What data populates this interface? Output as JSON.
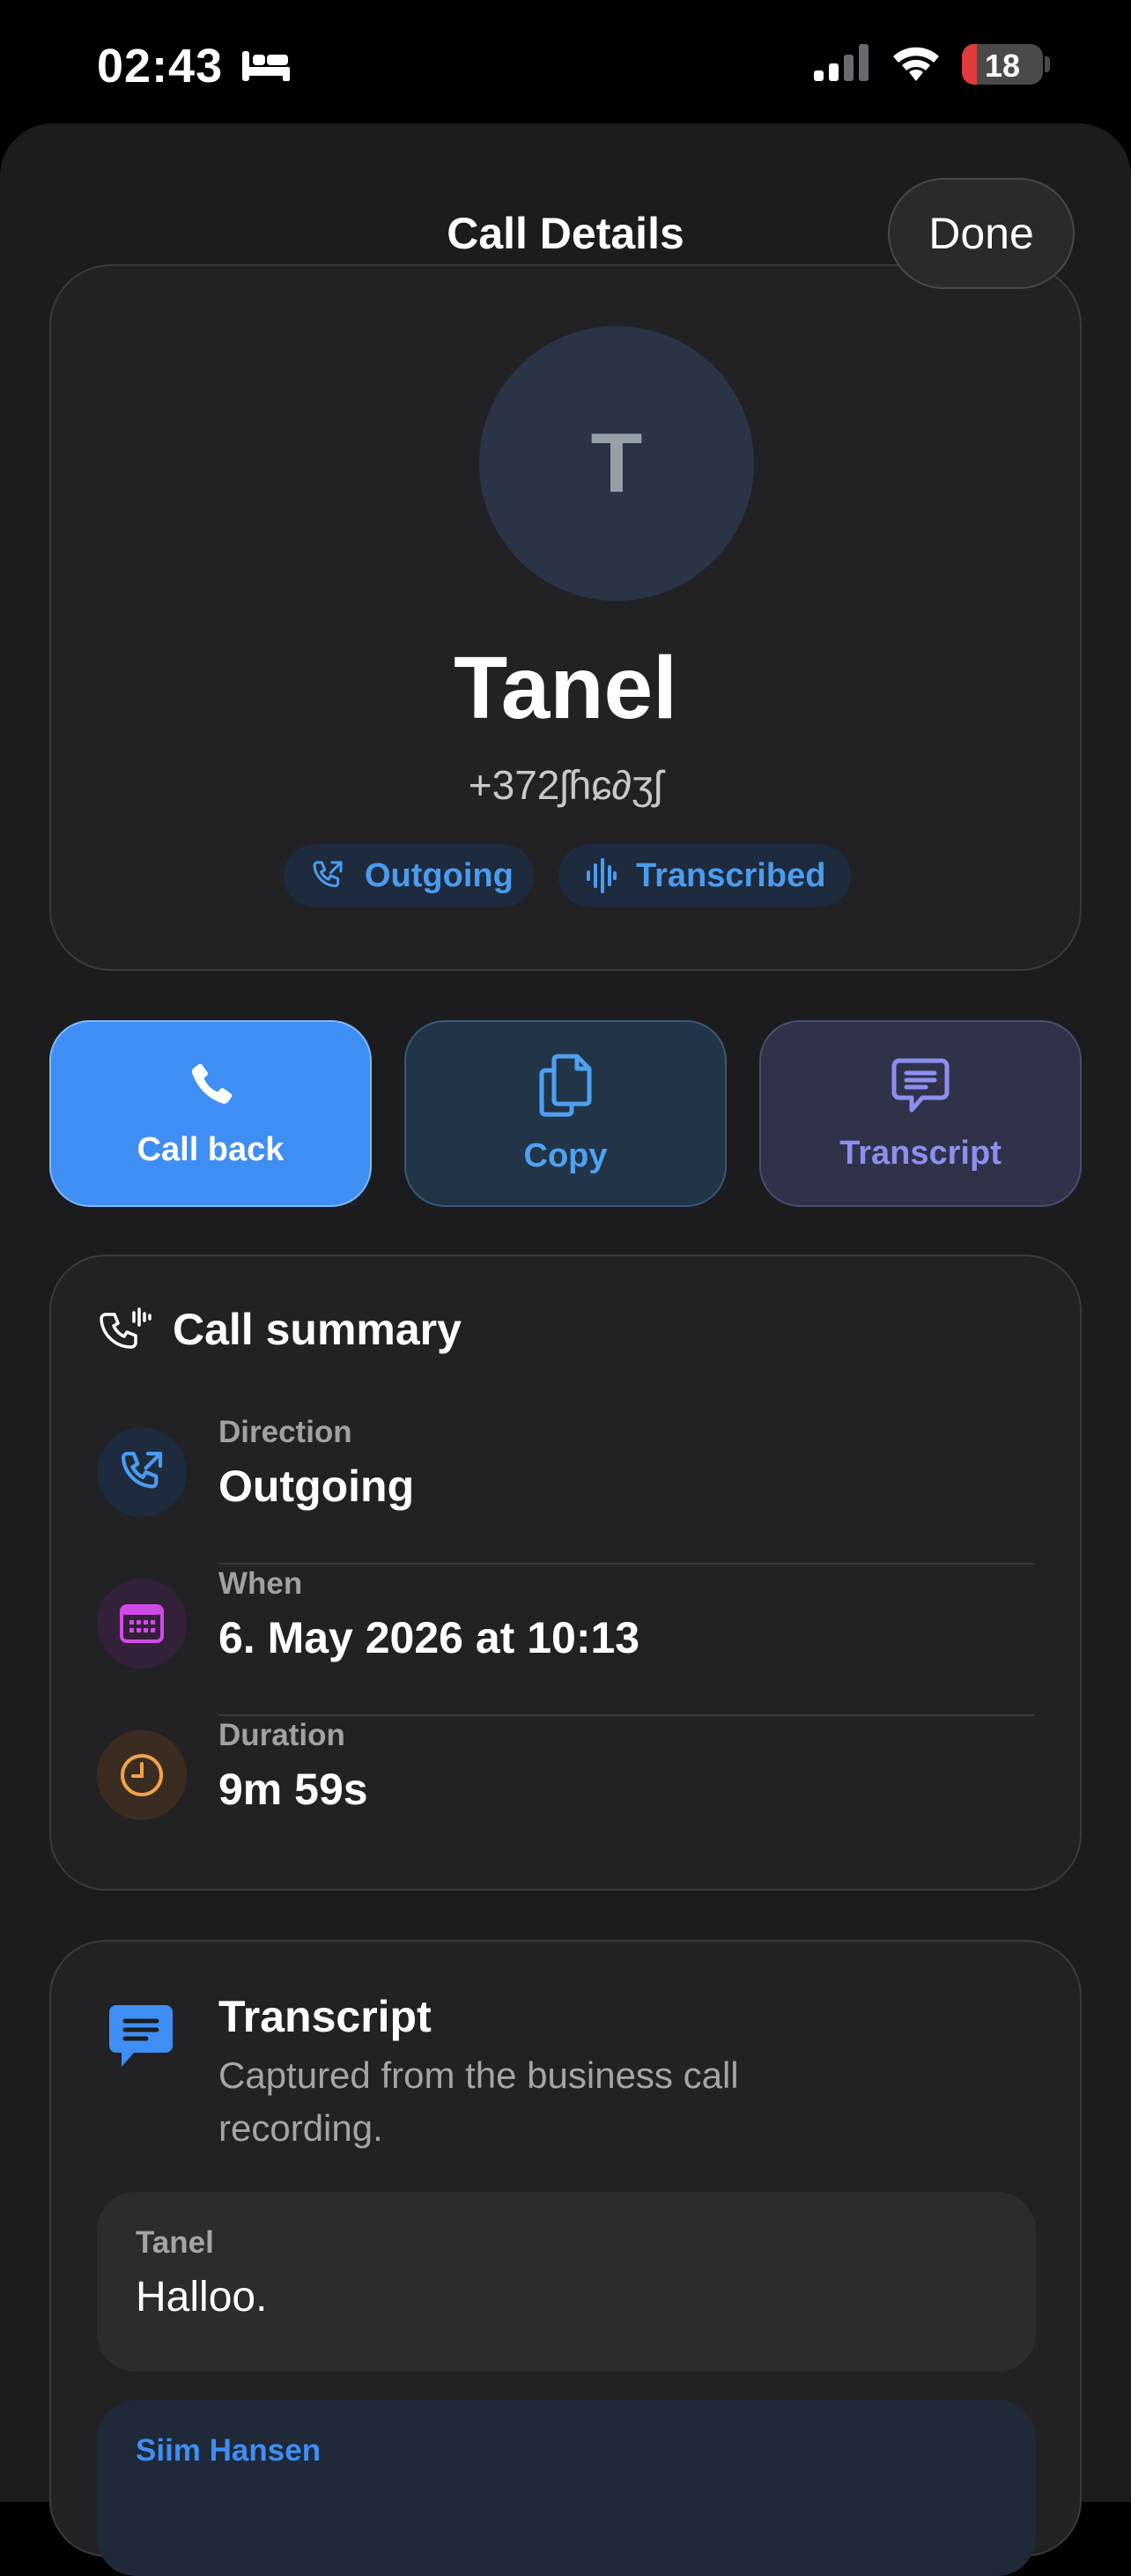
{
  "status_bar": {
    "time": "02:43",
    "battery": "18",
    "battery_level": 0.18,
    "focus_icon": "bed-icon"
  },
  "nav": {
    "title": "Call Details",
    "done_label": "Done"
  },
  "contact": {
    "initial": "T",
    "name": "Tanel",
    "phone": "+372ʃɦɕ∂ʒʃ",
    "chips": [
      {
        "label": "Outgoing",
        "icon": "outgoing-call-icon"
      },
      {
        "label": "Transcribed",
        "icon": "waveform-icon"
      }
    ]
  },
  "actions": [
    {
      "label": "Call back",
      "icon": "phone-icon",
      "color": "#3f8ef3"
    },
    {
      "label": "Copy",
      "icon": "copy-icon",
      "color": "#4ea1f1"
    },
    {
      "label": "Transcript",
      "icon": "message-icon",
      "color": "#8c8ff0"
    }
  ],
  "summary": {
    "title": "Call summary",
    "rows": [
      {
        "label": "Direction",
        "value": "Outgoing",
        "icon": "outgoing-call-icon",
        "color": "#4a9cf0"
      },
      {
        "label": "When",
        "value": "6. May 2026 at 10:13",
        "icon": "calendar-icon",
        "color": "#d24be8"
      },
      {
        "label": "Duration",
        "value": "9m 59s",
        "icon": "clock-icon",
        "color": "#f2a24a"
      }
    ]
  },
  "transcript": {
    "title": "Transcript",
    "subtitle": "Captured from the business call recording.",
    "messages": [
      {
        "speaker": "Tanel",
        "text": "Halloo."
      },
      {
        "speaker": "Siim Hansen",
        "text": ""
      }
    ]
  }
}
